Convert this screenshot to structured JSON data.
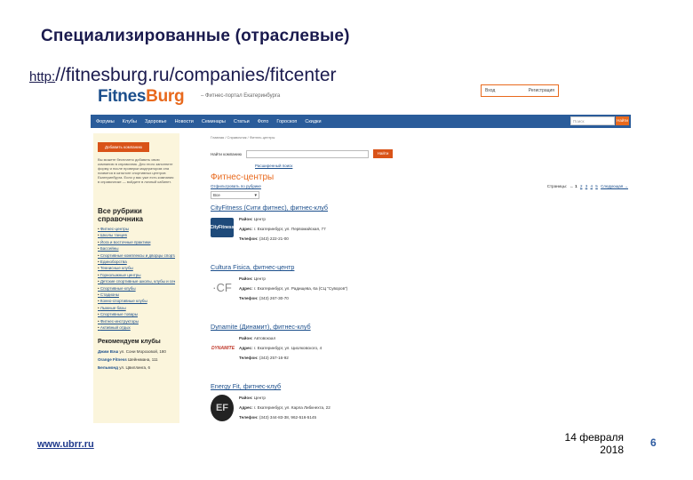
{
  "slide": {
    "title": "Специализированные (отраслевые)",
    "url_prefix": "http:",
    "url_rest": "//fitnesburg.ru/companies/fitcenter",
    "footer_link": "www.ubrr.ru",
    "date_line1": "14 февраля",
    "date_line2": "2018",
    "page_number": "6"
  },
  "site": {
    "logo_part1": "Fitnes",
    "logo_part2": "Burg",
    "tagline": "– Фитнес-портал Екатеринбурга",
    "userbox": {
      "login": "Вход",
      "register": "Регистрация"
    },
    "nav": [
      "Форумы",
      "Клубы",
      "Здоровье",
      "Новости",
      "Семинары",
      "Статьи",
      "Фото",
      "Гороскоп",
      "Скидки"
    ],
    "nav_search_placeholder": "Поиск",
    "nav_search_button": "Найти",
    "sidebar": {
      "add_button": "Добавить компанию",
      "note": "Вы можете бесплатно добавить свою компанию в справочник. Для этого заполните форму и после проверки модератором она появится в каталоге спортивных центров Екатеринбурга. Если у вас уже есть компания в справочнике — войдите в личный кабинет.",
      "heading": "Все рубрики справочника",
      "categories": [
        "Фитнес-центры",
        "Школы танцев",
        "Йога и восточные практики",
        "Бассейны",
        "Спортивные комплексы и дворцы спорта",
        "Единоборства",
        "Теннисные клубы",
        "Горнолыжные центры",
        "Детские спортивные школы, клубы и секции",
        "Спортивные клубы",
        "Стадионы",
        "Конно-спортивные клубы",
        "Лыжные базы",
        "Спортивные товары",
        "Фитнес-инструкторы",
        "Активный отдых"
      ],
      "rec_heading": "Рекомендуем клубы",
      "recommended": [
        {
          "name": "Джим Вэш",
          "address": "ул. Сони Морозовой, 180"
        },
        {
          "name": "Orange Fitness",
          "address": "Шейнкмана, 111"
        },
        {
          "name": "Бельмонд",
          "address": "ул. Цвиллинга, 6"
        }
      ]
    },
    "main": {
      "breadcrumbs": "Главная / Справочник / Фитнес-центры",
      "search_label": "Найти компанию",
      "search_button": "Найти",
      "advanced_search": "Расширенный поиск",
      "page_heading": "Фитнес-центры",
      "filter_link": "Отфильтровать по рубрике",
      "pagination_label": "Страницы:",
      "pages": [
        "← 1",
        "2",
        "3",
        "4",
        "5",
        "Следующая →"
      ],
      "select_value": "Все",
      "labels": {
        "area": "Район:",
        "address": "Адрес:",
        "phone": "Телефон:"
      },
      "clubs": [
        {
          "name": "CityFitness (Сити фитнес), фитнес-клуб",
          "logo": "CityFitness",
          "area": "Центр",
          "address": "г. Екатеринбург, ул. Первомайская, 77",
          "phone": "(343) 222-21-00"
        },
        {
          "name": "Cultura Fisica, фитнес-центр",
          "logo": "·CF",
          "area": "Центр",
          "address": "г. Екатеринбург, ул. Радищева, 6а (СЦ \"Суворов\")",
          "phone": "(343) 267-30-70"
        },
        {
          "name": "Dynamite (Динамит), фитнес-клуб",
          "logo": "DYNAMITE",
          "area": "Автовокзал",
          "address": "г. Екатеринбург, ул. Циолковского, 4",
          "phone": "(343) 257-16-92"
        },
        {
          "name": "Energy Fit, фитнес-клуб",
          "logo": "EF",
          "area": "Центр",
          "address": "г. Екатеринбург, ул. Карла Либкнехта, 22",
          "phone": "(343) 344-83-38, 962-516-5145"
        }
      ]
    }
  }
}
